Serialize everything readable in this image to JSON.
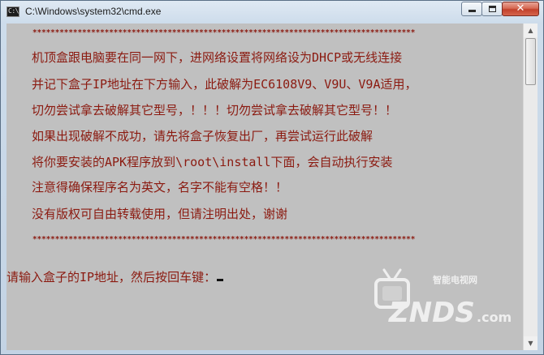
{
  "window": {
    "title": "C:\\Windows\\system32\\cmd.exe",
    "close_label": "✕"
  },
  "console": {
    "divider": "*************************************************************************************",
    "lines": [
      "机顶盒跟电脑要在同一网下，进网络设置将网络设为DHCP或无线连接",
      "并记下盒子IP地址在下方输入，此破解为EC6108V9、V9U、V9A适用，",
      "切勿尝试拿去破解其它型号，！！！切勿尝试拿去破解其它型号！！",
      "如果出现破解不成功，请先将盒子恢复出厂，再尝试运行此破解",
      "将你要安装的APK程序放到\\root\\install下面，会自动执行安装",
      "注意得确保程序名为英文，名字不能有空格！！",
      "没有版权可自由转载使用，但请注明出处，谢谢"
    ],
    "prompt": "请输入盒子的IP地址，然后按回车键："
  },
  "watermark": {
    "brand": "ZNDS",
    "domain": ".com",
    "tagline": "智能电视网"
  },
  "colors": {
    "console_bg": "#c0c0c0",
    "console_text": "#8b1a10",
    "close_button": "#c2412b"
  },
  "icons": [
    "cmd-icon",
    "minimize-icon",
    "maximize-icon",
    "close-icon",
    "scroll-up-icon",
    "scroll-down-icon",
    "tv-logo-icon"
  ]
}
